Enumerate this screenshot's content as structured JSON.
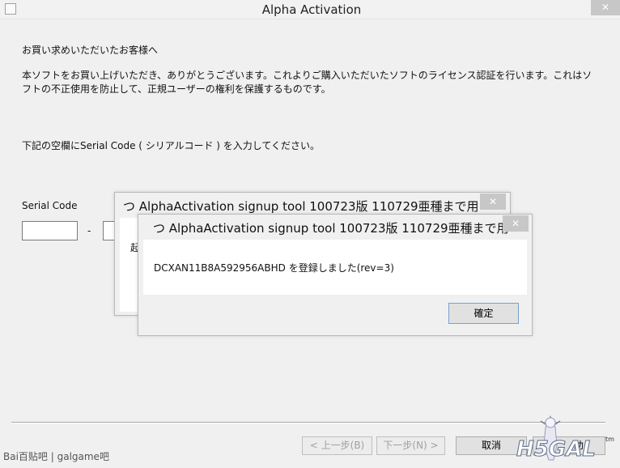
{
  "window": {
    "title": "Alpha Activation",
    "close_glyph": "✕",
    "icon": "app-icon"
  },
  "content": {
    "greeting": "お買い求めいただいたお客様へ",
    "intro_line1": "本ソフトをお買い上げいただき、ありがとうございます。これよりご購入いただいたソフトのライセンス認証を行います。これはソ",
    "intro_line2": "フトの不正使用を防止して、正規ユーザーの権利を保護するものです。",
    "instruction": "下記の空欄にSerial Code ( シリアルコード ) を入力してください。",
    "serial_label": "Serial Code",
    "serial_separator": "-"
  },
  "back_dialog": {
    "title": "つ AlphaActivation signup tool 100723版 110729亜種まで用",
    "close_glyph": "✕",
    "partial_text": "起"
  },
  "front_dialog": {
    "title": "つ AlphaActivation signup tool 100723版 110729亜種まで用",
    "close_glyph": "✕",
    "message": "DCXAN11B8A592956ABHD を登録しました(rev=3)",
    "ok_label": "確定"
  },
  "footer": {
    "back_label": "< 上一步(B)",
    "next_label": "下一步(N) >",
    "cancel_label": "取消",
    "help_partial": "助"
  },
  "watermark": {
    "left_text": "Bai百贴吧 | galgame吧",
    "right_logo": "H5GAL",
    "right_mark": "tm"
  }
}
